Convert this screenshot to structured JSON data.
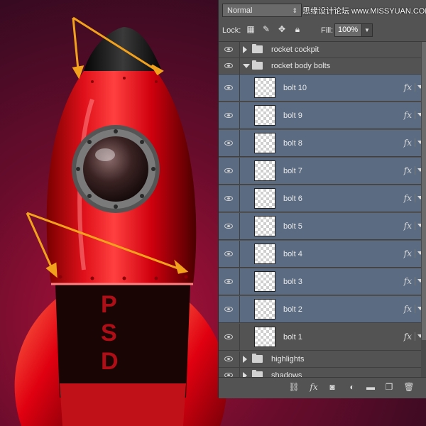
{
  "panel": {
    "blend_mode": "Normal",
    "watermark": "思缘设计论坛 www.MISSYUAN.COM",
    "lock_label": "Lock:",
    "lock_icons": [
      "lock-transparent-icon",
      "lock-brush-icon",
      "lock-move-icon",
      "lock-all-icon"
    ],
    "fill_label": "Fill:",
    "fill_value": "100%"
  },
  "layers": {
    "group_cockpit": "rocket cockpit",
    "group_body": "rocket body bolts",
    "bolts": [
      "bolt 10",
      "bolt 9",
      "bolt 8",
      "bolt 7",
      "bolt 6",
      "bolt 5",
      "bolt 4",
      "bolt 3",
      "bolt 2",
      "bolt 1"
    ],
    "fx_label": "fx",
    "group_highlights": "highlights",
    "group_shadows": "shadows"
  },
  "bottom_icons": [
    "link-icon",
    "fx-icon",
    "mask-icon",
    "adjustment-icon",
    "folder-icon",
    "new-layer-icon",
    "trash-icon"
  ],
  "artwork": {
    "rocket_text": "PSD",
    "arrow_color": "#f2a11c",
    "rocket_color": "#e00010"
  }
}
